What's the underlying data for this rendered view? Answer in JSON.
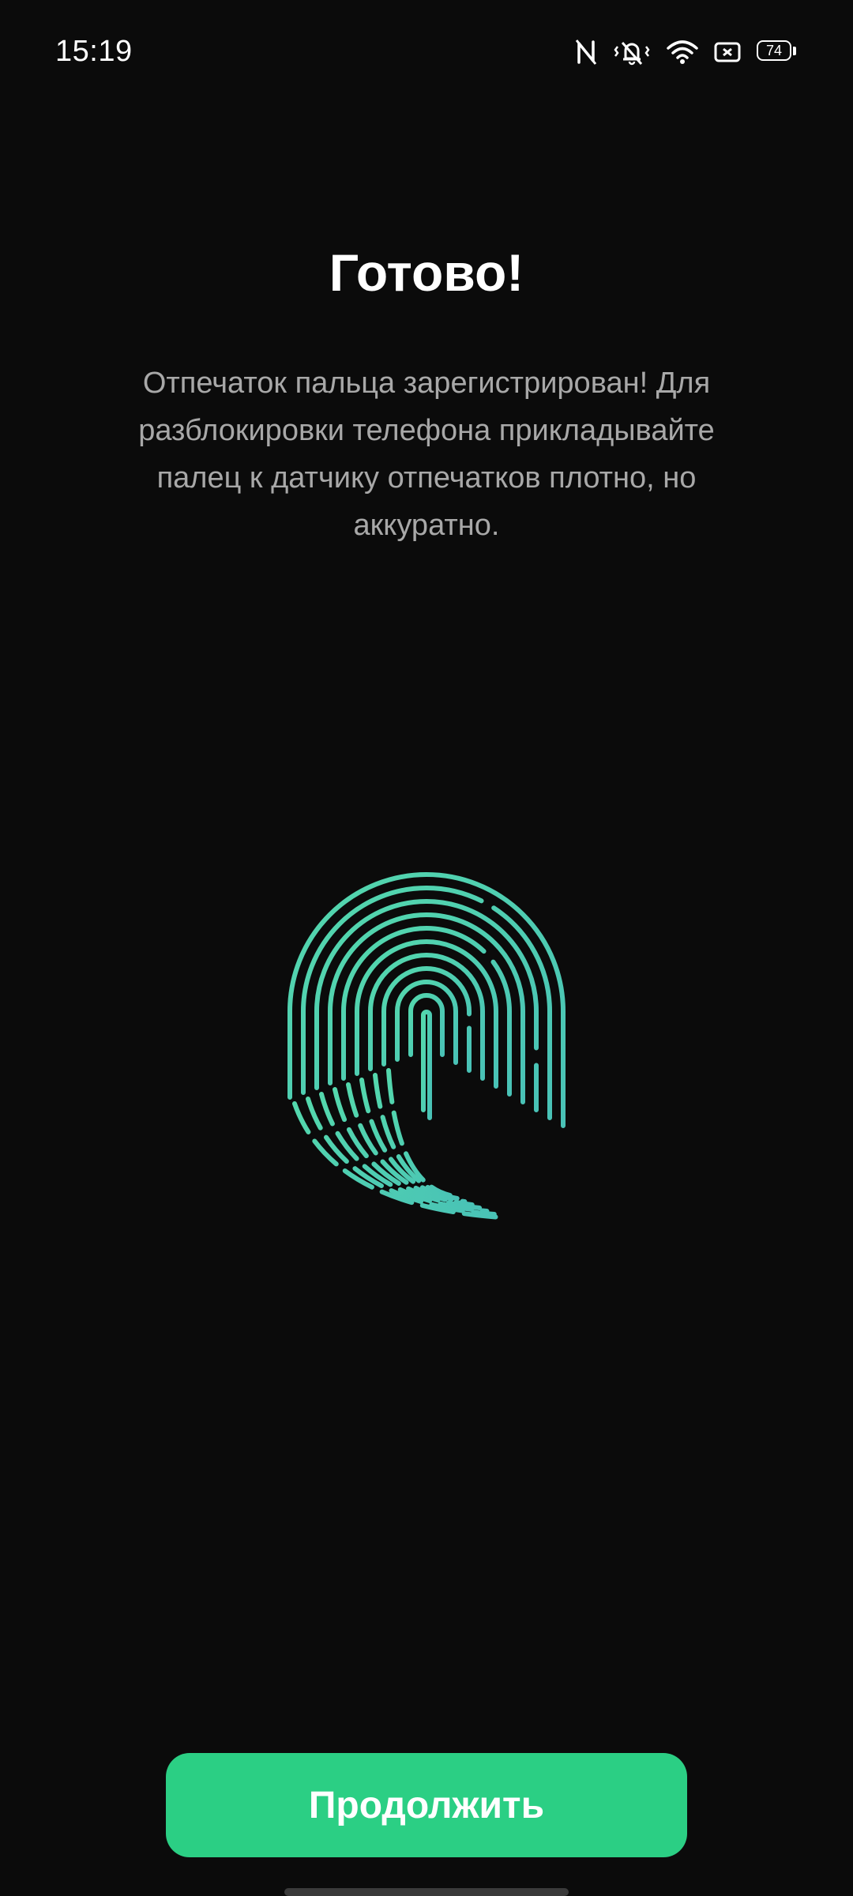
{
  "status_bar": {
    "time": "15:19",
    "battery_level": "74",
    "icons": [
      "nfc-icon",
      "vibrate-mute-icon",
      "wifi-icon",
      "notification-icon",
      "battery-icon"
    ]
  },
  "content": {
    "title": "Готово!",
    "description": "Отпечаток пальца зарегистрирован! Для разблокировки телефона прикладывайте палец к датчику отпечатков плотно, но аккуратно.",
    "illustration_icon": "fingerprint-icon",
    "accent_color": "#4fd1b0"
  },
  "actions": {
    "continue_label": "Продолжить",
    "button_color": "#2bcf84"
  }
}
